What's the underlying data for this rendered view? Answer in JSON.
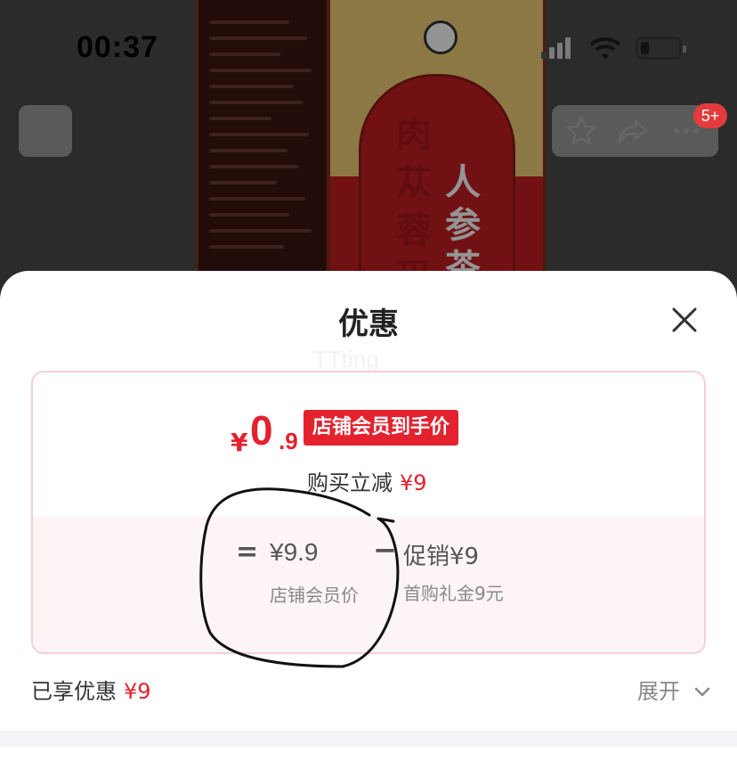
{
  "status_bar": {
    "time": "00:37"
  },
  "product_image": {
    "side_text": "肉苁蓉玛",
    "front_text": "人参茶"
  },
  "nav": {
    "back_icon": "chevron-left-icon",
    "favorite_icon": "star-icon",
    "share_icon": "share-icon",
    "more_icon": "more-icon",
    "badge": "5+"
  },
  "sheet": {
    "title": "优惠",
    "close_icon": "close-icon",
    "watermark": "TTting"
  },
  "price_card": {
    "currency": "¥",
    "price_integer": "0",
    "price_decimal": ".9",
    "price_tag": "店铺会员到手价",
    "reduce_label": "购买立减",
    "reduce_value": "¥9",
    "breakdown": {
      "equals_sign": "=",
      "store_price": "¥9.9",
      "store_label": "店铺会员价",
      "minus_sign": "−",
      "promo_price": "促销¥9",
      "promo_label": "首购礼金9元"
    }
  },
  "footer": {
    "enjoyed_label": "已享优惠",
    "enjoyed_value": "¥9",
    "expand_label": "展开"
  },
  "colors": {
    "accent_red": "#e3222e",
    "card_border": "#f6cfd4",
    "card_lower_bg": "#fdf4f5"
  }
}
